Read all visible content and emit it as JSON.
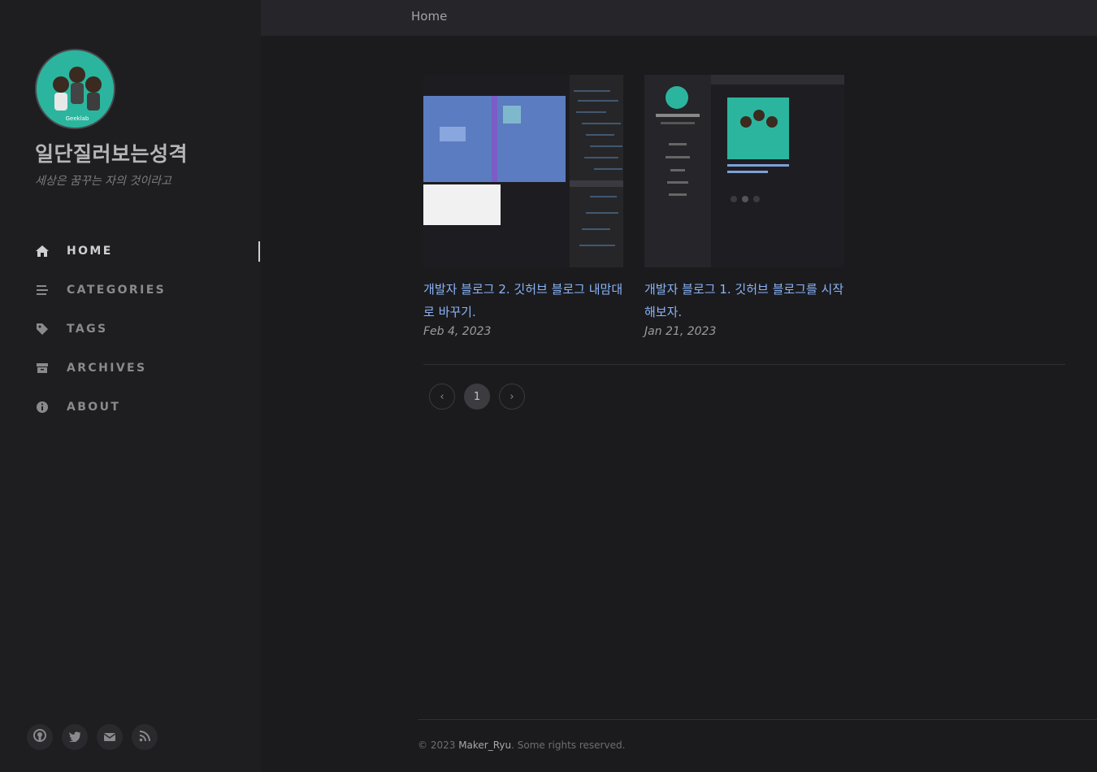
{
  "sidebar": {
    "title": "일단질러보는성격",
    "subtitle": "세상은 꿈꾸는 자의 것이라고",
    "nav": [
      {
        "label": "HOME",
        "icon": "home-icon",
        "active": true
      },
      {
        "label": "CATEGORIES",
        "icon": "stream-icon",
        "active": false
      },
      {
        "label": "TAGS",
        "icon": "tag-icon",
        "active": false
      },
      {
        "label": "ARCHIVES",
        "icon": "archive-icon",
        "active": false
      },
      {
        "label": "ABOUT",
        "icon": "info-icon",
        "active": false
      }
    ],
    "social": [
      "github-icon",
      "twitter-icon",
      "email-icon",
      "rss-icon"
    ]
  },
  "topbar": {
    "breadcrumb": "Home"
  },
  "posts": [
    {
      "title": "개발자 블로그 2. 깃허브 블로그 내맘대로 바꾸기.",
      "date": "Feb 4, 2023"
    },
    {
      "title": "개발자 블로그 1. 깃허브 블로그를 시작해보자.",
      "date": "Jan 21, 2023"
    }
  ],
  "pagination": {
    "prev": "‹",
    "current": "1",
    "next": "›"
  },
  "footer": {
    "copyright": "© 2023",
    "author": "Maker_Ryu",
    "rights": ". Some rights reserved."
  },
  "colors": {
    "accent": "#8ab4f8",
    "background": "#1b1b1e",
    "sidebar": "#1e1e21",
    "avatar_bg": "#2bb59e"
  }
}
